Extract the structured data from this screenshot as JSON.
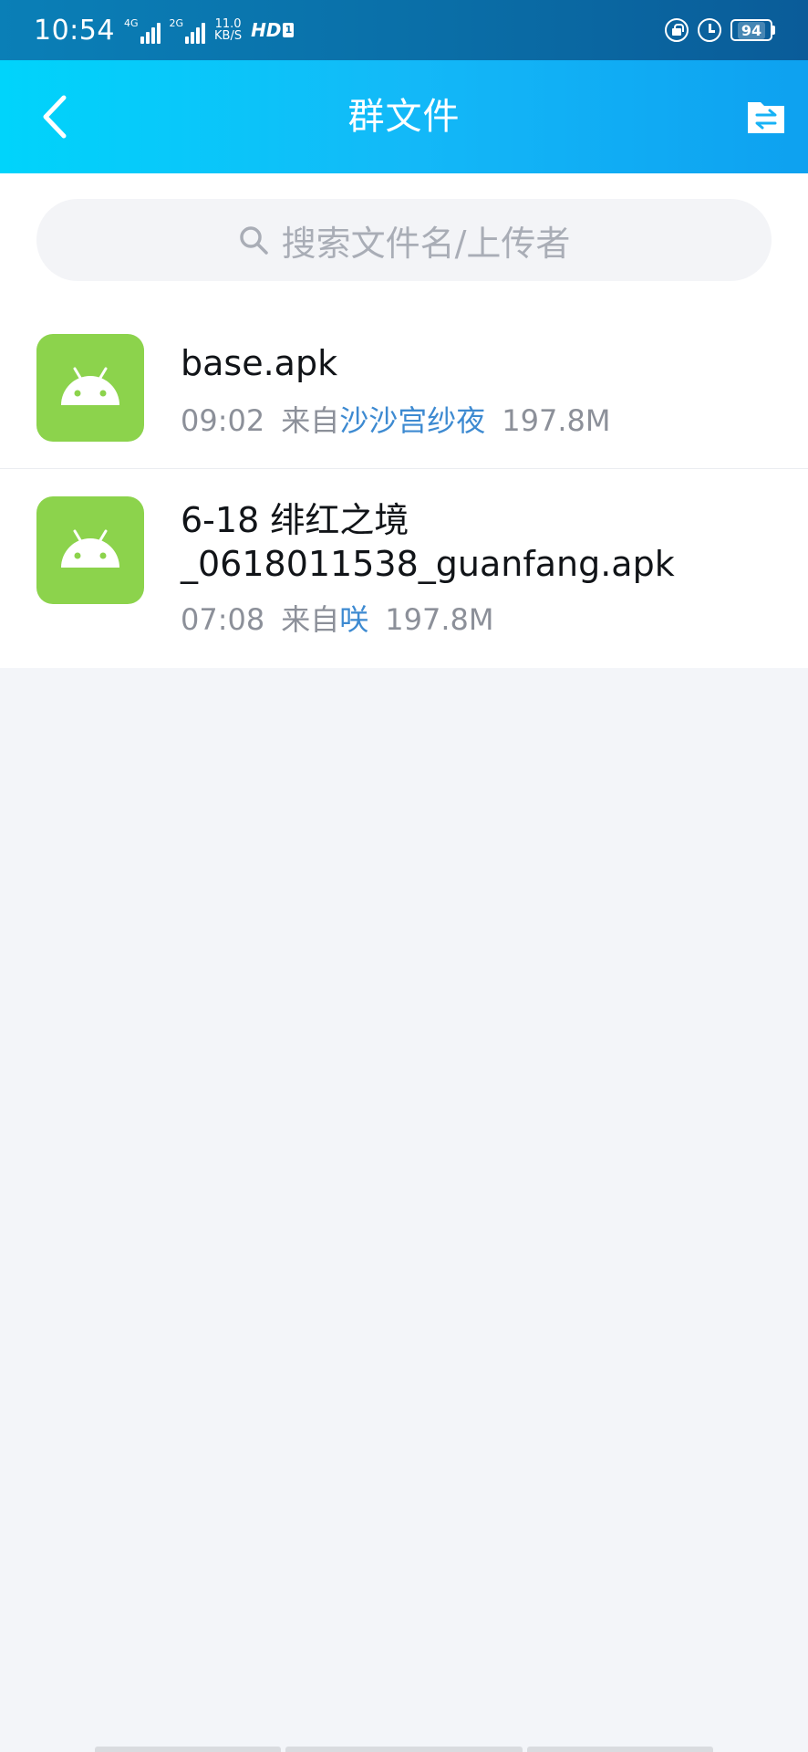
{
  "status_bar": {
    "time": "10:54",
    "net1_label": "4G",
    "net2_label": "2G",
    "speed_value": "11.0",
    "speed_unit": "KB/S",
    "hd_label": "HD",
    "sim_label": "1",
    "battery": "94"
  },
  "header": {
    "title": "群文件",
    "back_icon": "chevron-left-icon",
    "transfer_icon": "file-transfer-icon"
  },
  "search": {
    "placeholder": "搜索文件名/上传者"
  },
  "colors": {
    "header_accent": "#13b9f8",
    "apk_icon_bg": "#8cd34c",
    "uploader_link": "#3d8ad1"
  },
  "files": [
    {
      "name": "base.apk",
      "time": "09:02",
      "from_label": "来自",
      "uploader": "沙沙宫纱夜",
      "size": "197.8M",
      "icon": "android-icon"
    },
    {
      "name": "6-18 绯红之境_0618011538_guanfang.apk",
      "time": "07:08",
      "from_label": "来自",
      "uploader": "咲",
      "size": "197.8M",
      "icon": "android-icon"
    }
  ]
}
